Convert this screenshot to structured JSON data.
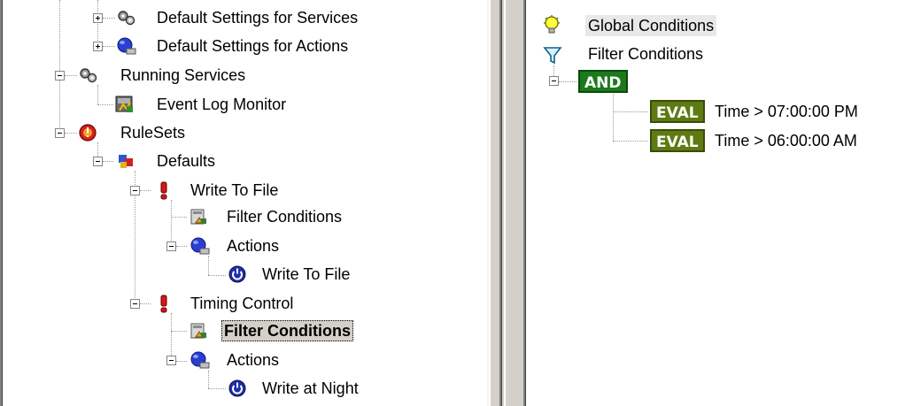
{
  "left_tree": {
    "items": [
      {
        "label": "Default Settings for Services",
        "icon": "gears-icon",
        "expander": "plus"
      },
      {
        "label": "Default Settings for Actions",
        "icon": "actions-icon",
        "expander": "plus"
      },
      {
        "label": "Running Services",
        "icon": "gears-icon",
        "expander": "minus"
      },
      {
        "label": "Event Log Monitor",
        "icon": "event-log-icon",
        "expander": "none"
      },
      {
        "label": "RuleSets",
        "icon": "rulesets-icon",
        "expander": "minus"
      },
      {
        "label": "Defaults",
        "icon": "ruleset-icon",
        "expander": "minus"
      },
      {
        "label": "Write To File",
        "icon": "rule-icon",
        "expander": "minus"
      },
      {
        "label": "Filter Conditions",
        "icon": "filter-conditions-icon",
        "expander": "none"
      },
      {
        "label": "Actions",
        "icon": "actions-icon",
        "expander": "minus"
      },
      {
        "label": "Write To File",
        "icon": "power-icon",
        "expander": "none"
      },
      {
        "label": "Timing Control",
        "icon": "rule-icon",
        "expander": "minus"
      },
      {
        "label": "Filter Conditions",
        "icon": "filter-conditions-icon",
        "expander": "none",
        "selected": true
      },
      {
        "label": "Actions",
        "icon": "actions-icon",
        "expander": "minus"
      },
      {
        "label": "Write at Night",
        "icon": "power-icon",
        "expander": "none"
      }
    ]
  },
  "right_tree": {
    "global_conditions": "Global Conditions",
    "filter_conditions": "Filter Conditions",
    "and_label": "AND",
    "conditions": [
      {
        "badge": "EVAL",
        "text": "Time > 07:00:00 PM"
      },
      {
        "badge": "EVAL",
        "text": "Time > 06:00:00 AM"
      }
    ]
  },
  "colors": {
    "and_badge": "#1b7a1b",
    "eval_badge": "#5e7a13",
    "splitter": "#d4d0c8",
    "selection": "#d4d0c8"
  }
}
